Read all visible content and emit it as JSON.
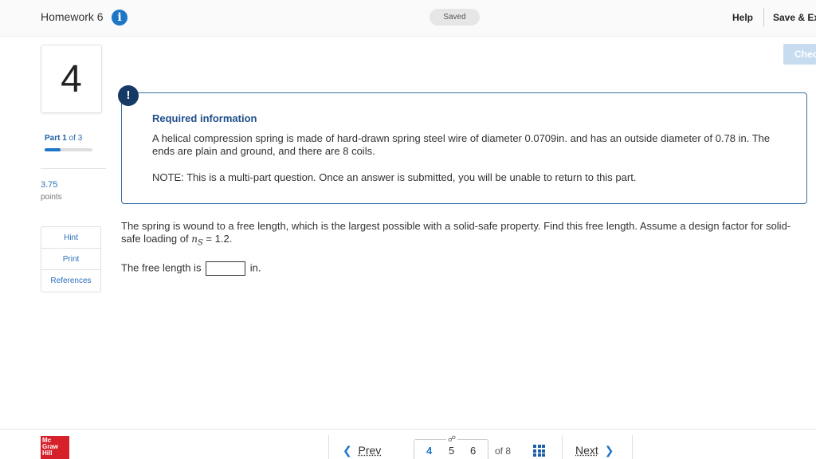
{
  "header": {
    "title": "Homework 6",
    "info_icon": "i",
    "saved_status": "Saved",
    "help_label": "Help",
    "save_exit_label": "Save & Ex",
    "check_label": "Chec"
  },
  "left": {
    "question_number": "4",
    "part_prefix": "Part",
    "part_current": "1",
    "part_of": "of 3",
    "progress_fraction": 0.33,
    "points_value": "3.75",
    "points_label": "points",
    "links": [
      "Hint",
      "Print",
      "References"
    ]
  },
  "required_info": {
    "icon": "!",
    "title": "Required information",
    "text": "A helical compression spring is made of hard-drawn spring steel wire of diameter 0.0709in. and has an outside diameter of 0.78 in. The ends are plain and ground, and there are 8 coils.",
    "note": "NOTE: This is a multi-part question. Once an answer is submitted, you will be unable to return to this part."
  },
  "question": {
    "text": "The spring is wound to a free length, which is the largest possible with a solid-safe property. Find this free length. Assume a design factor for solid-safe loading of",
    "math_symbol": "n",
    "math_sub": "S",
    "math_value": "= 1.2.",
    "answer_prefix": "The free length is",
    "answer_value": "",
    "answer_unit": "in."
  },
  "footer": {
    "logo_lines": [
      "Mc",
      "Graw",
      "Hill"
    ],
    "prev_label": "Prev",
    "next_label": "Next",
    "pages": [
      "4",
      "5",
      "6"
    ],
    "current_page": "4",
    "of_total": "of 8",
    "link_icon": "link-icon",
    "grid_icon": "grid-icon"
  },
  "colors": {
    "accent": "#1f76c7",
    "panel_border": "#3a6ea5",
    "alert_bg": "#163a66",
    "logo_red": "#d6202a"
  }
}
